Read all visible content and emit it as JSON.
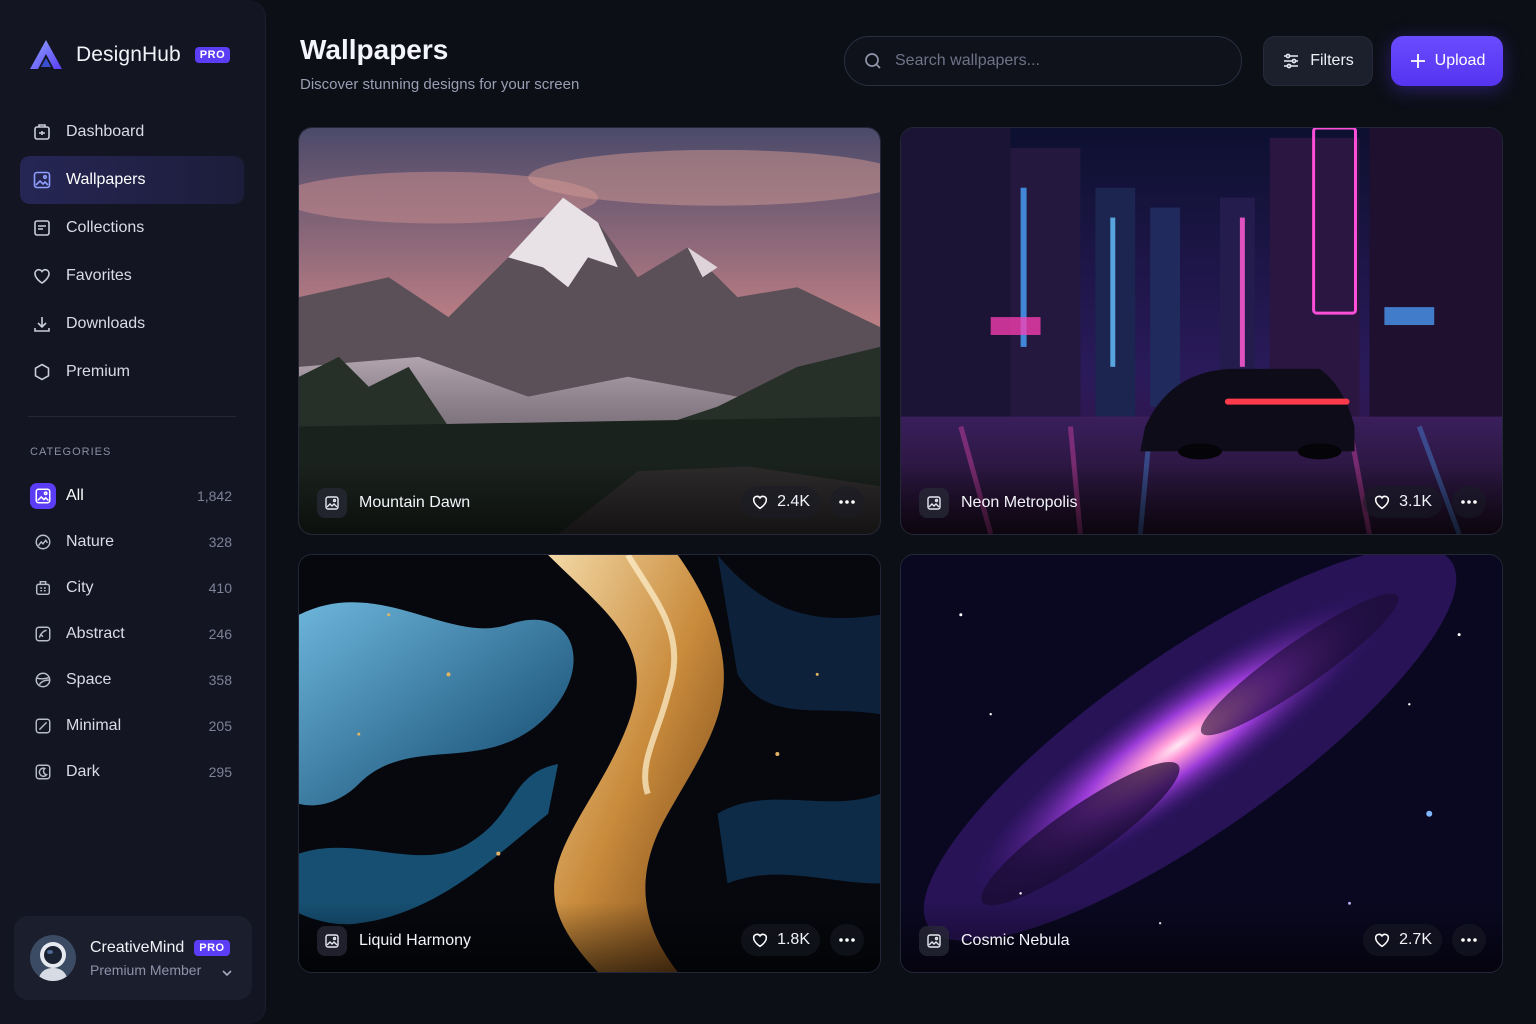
{
  "brand": {
    "name": "DesignHub",
    "badge": "PRO"
  },
  "nav": [
    {
      "label": "Dashboard",
      "icon": "dashboard-icon"
    },
    {
      "label": "Wallpapers",
      "icon": "image-icon",
      "active": true
    },
    {
      "label": "Collections",
      "icon": "collection-icon"
    },
    {
      "label": "Favorites",
      "icon": "heart-icon"
    },
    {
      "label": "Downloads",
      "icon": "download-icon"
    },
    {
      "label": "Premium",
      "icon": "hexagon-icon"
    }
  ],
  "categories": {
    "heading": "CATEGORIES",
    "items": [
      {
        "label": "All",
        "count": "1,842",
        "icon": "image-icon",
        "active": true
      },
      {
        "label": "Nature",
        "count": "328",
        "icon": "nature-icon"
      },
      {
        "label": "City",
        "count": "410",
        "icon": "city-icon"
      },
      {
        "label": "Abstract",
        "count": "246",
        "icon": "abstract-icon"
      },
      {
        "label": "Space",
        "count": "358",
        "icon": "space-icon"
      },
      {
        "label": "Minimal",
        "count": "205",
        "icon": "minimal-icon"
      },
      {
        "label": "Dark",
        "count": "295",
        "icon": "dark-icon"
      }
    ]
  },
  "user": {
    "name": "CreativeMind",
    "badge": "PRO",
    "role": "Premium Member"
  },
  "header": {
    "title": "Wallpapers",
    "subtitle": "Discover stunning designs for your screen",
    "search_placeholder": "Search wallpapers...",
    "filters_label": "Filters",
    "upload_label": "Upload"
  },
  "wallpapers": [
    {
      "title": "Mountain Dawn",
      "likes": "2.4K"
    },
    {
      "title": "Neon Metropolis",
      "likes": "3.1K"
    },
    {
      "title": "Liquid Harmony",
      "likes": "1.8K"
    },
    {
      "title": "Cosmic Nebula",
      "likes": "2.7K"
    }
  ],
  "colors": {
    "accent": "#5b3df5",
    "background": "#0d0f17",
    "sidebar": "#131622"
  }
}
